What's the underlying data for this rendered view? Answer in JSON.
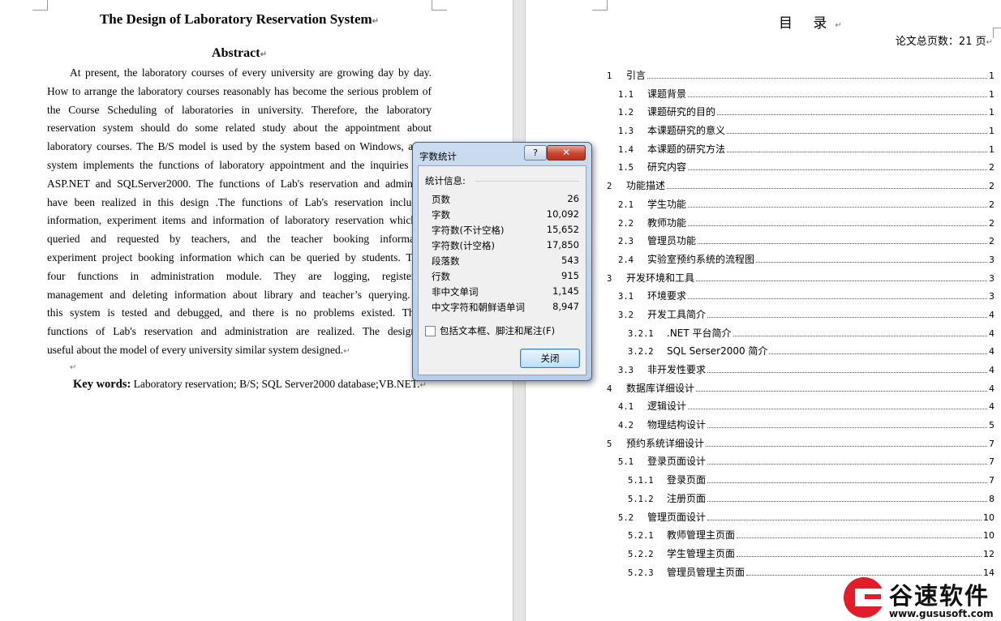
{
  "left": {
    "title": "The Design of Laboratory Reservation System",
    "abstract_heading": "Abstract",
    "abstract_lines": [
      "At present, the laboratory courses of every university are growing day by day.",
      "How to arrange the laboratory courses reasonably has become the serious problem of",
      "the Course Scheduling of laboratories in university. Therefore, the laboratory",
      "reservation system should do some related study about the appointment about",
      "laboratory courses. The B/S model is used by the system based on Windows, and t",
      "system implements the functions of laboratory appointment and the inquiries thro",
      "ASP.NET and SQLServer2000. The functions of Lab's reservation and administra",
      "have been realized in this design .The functions of Lab's reservation include l",
      "information, experiment items and information of laboratory reservation which ca",
      "queried and requested by teachers, and the teacher booking information",
      "experiment project booking information which can be queried by students. There",
      "four functions in administration module. They are logging, registering,",
      "management and deleting information about library and teacher’s querying. Fin",
      "this system is tested and debugged, and there is no problems existed. The b",
      "functions of Lab's reservation and administration are realized. The design is",
      "useful about the model of every university similar system designed."
    ],
    "keywords_label": "Key words:",
    "keywords_text": " Laboratory reservation; B/S; SQL Server2000 database;VB.NET."
  },
  "right": {
    "toc_title": "目 录",
    "total_pages": "论文总页数：21 页",
    "toc": [
      {
        "num": "1",
        "label": "引言",
        "page": "1",
        "level": 1
      },
      {
        "num": "1.1",
        "label": "课题背景",
        "page": "1",
        "level": 2
      },
      {
        "num": "1.2",
        "label": "课题研究的目的",
        "page": "1",
        "level": 2
      },
      {
        "num": "1.3",
        "label": "本课题研究的意义",
        "page": "1",
        "level": 2
      },
      {
        "num": "1.4",
        "label": "本课题的研究方法",
        "page": "1",
        "level": 2
      },
      {
        "num": "1.5",
        "label": "研究内容",
        "page": "2",
        "level": 2
      },
      {
        "num": "2",
        "label": "功能描述",
        "page": "2",
        "level": 1
      },
      {
        "num": "2.1",
        "label": "学生功能",
        "page": "2",
        "level": 2
      },
      {
        "num": "2.2",
        "label": "教师功能",
        "page": "2",
        "level": 2
      },
      {
        "num": "2.3",
        "label": "管理员功能",
        "page": "2",
        "level": 2
      },
      {
        "num": "2.4",
        "label": "实验室预约系统的流程图",
        "page": "3",
        "level": 2
      },
      {
        "num": "3",
        "label": "开发环境和工具",
        "page": "3",
        "level": 1
      },
      {
        "num": "3.1",
        "label": "环境要求",
        "page": "3",
        "level": 2
      },
      {
        "num": "3.2",
        "label": "开发工具简介",
        "page": "4",
        "level": 2
      },
      {
        "num": "3.2.1",
        "label": ".NET 平台简介",
        "page": "4",
        "level": 3
      },
      {
        "num": "3.2.2",
        "label": "SQL Serser2000 简介",
        "page": "4",
        "level": 3
      },
      {
        "num": "3.3",
        "label": "非开发性要求",
        "page": "4",
        "level": 2
      },
      {
        "num": "4",
        "label": "数据库详细设计",
        "page": "4",
        "level": 1
      },
      {
        "num": "4.1",
        "label": "逻辑设计",
        "page": "4",
        "level": 2
      },
      {
        "num": "4.2",
        "label": "物理结构设计",
        "page": "5",
        "level": 2
      },
      {
        "num": "5",
        "label": "预约系统详细设计",
        "page": "7",
        "level": 1
      },
      {
        "num": "5.1",
        "label": "登录页面设计",
        "page": "7",
        "level": 2
      },
      {
        "num": "5.1.1",
        "label": "登录页面",
        "page": "7",
        "level": 3
      },
      {
        "num": "5.1.2",
        "label": "注册页面",
        "page": "8",
        "level": 3
      },
      {
        "num": "5.2",
        "label": "管理页面设计",
        "page": "10",
        "level": 2
      },
      {
        "num": "5.2.1",
        "label": "教师管理主页面",
        "page": "10",
        "level": 3
      },
      {
        "num": "5.2.2",
        "label": "学生管理主页面",
        "page": "12",
        "level": 3
      },
      {
        "num": "5.2.3",
        "label": "管理员管理主页面",
        "page": "14",
        "level": 3
      }
    ]
  },
  "dialog": {
    "title": "字数统计",
    "help_label": "?",
    "close_label": "✕",
    "section_label": "统计信息:",
    "stats": [
      {
        "label": "页数",
        "value": "26"
      },
      {
        "label": "字数",
        "value": "10,092"
      },
      {
        "label": "字符数(不计空格)",
        "value": "15,652"
      },
      {
        "label": "字符数(计空格)",
        "value": "17,850"
      },
      {
        "label": "段落数",
        "value": "543"
      },
      {
        "label": "行数",
        "value": "915"
      },
      {
        "label": "非中文单词",
        "value": "1,145"
      },
      {
        "label": "中文字符和朝鲜语单词",
        "value": "8,947"
      }
    ],
    "checkbox_label": "包括文本框、脚注和尾注(F)",
    "checkbox_checked": false,
    "ok_label": "关闭"
  },
  "watermark": {
    "brand_cn": "谷速软件",
    "url": "www.gususoft.com",
    "brand_color": "#e31c2a"
  },
  "paragraph_mark": "↵"
}
